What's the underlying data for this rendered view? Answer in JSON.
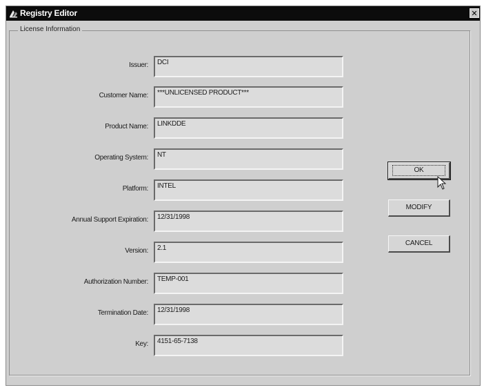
{
  "window": {
    "title": "Registry Editor",
    "close_glyph": "✕"
  },
  "group": {
    "legend": "License Information"
  },
  "fields": [
    {
      "label": "Issuer:",
      "value": "DCI"
    },
    {
      "label": "Customer Name:",
      "value": "***UNLICENSED PRODUCT***"
    },
    {
      "label": "Product Name:",
      "value": "LINKDDE"
    },
    {
      "label": "Operating System:",
      "value": "NT"
    },
    {
      "label": "Platform:",
      "value": "INTEL"
    },
    {
      "label": "Annual Support Expiration:",
      "value": "12/31/1998"
    },
    {
      "label": "Version:",
      "value": "2.1"
    },
    {
      "label": "Authorization Number:",
      "value": "TEMP-001"
    },
    {
      "label": "Termination Date:",
      "value": "12/31/1998"
    },
    {
      "label": "Key:",
      "value": "4151-65-7138"
    }
  ],
  "buttons": {
    "ok": "OK",
    "modify": "MODIFY",
    "cancel": "CANCEL"
  },
  "icons": {
    "app": "registry-app-icon",
    "close": "close-icon",
    "pointer": "mouse-pointer-icon"
  }
}
